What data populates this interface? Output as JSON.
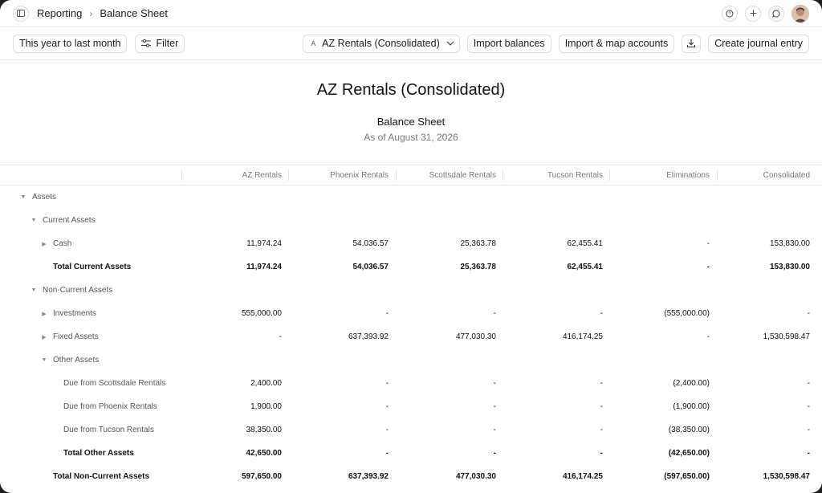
{
  "breadcrumb": {
    "section": "Reporting",
    "page": "Balance Sheet"
  },
  "toolbar": {
    "date_range": "This year to last month",
    "filter": "Filter",
    "entity_letter": "A",
    "entity": "AZ Rentals (Consolidated)",
    "import_balances": "Import balances",
    "import_map": "Import & map accounts",
    "create_journal": "Create journal entry"
  },
  "report": {
    "title": "AZ Rentals (Consolidated)",
    "subtitle": "Balance Sheet",
    "date": "As of August 31, 2026"
  },
  "columns": [
    "AZ Rentals",
    "Phoenix Rentals",
    "Scottsdale Rentals",
    "Tucson Rentals",
    "Eliminations",
    "Consolidated"
  ],
  "rows": [
    {
      "label": "Assets",
      "indent": 0,
      "caret": "down",
      "total": false,
      "values": []
    },
    {
      "label": "Current Assets",
      "indent": 1,
      "caret": "down",
      "total": false,
      "values": []
    },
    {
      "label": "Cash",
      "indent": 2,
      "caret": "right",
      "total": false,
      "values": [
        "11,974.24",
        "54,036.57",
        "25,363.78",
        "62,455.41",
        "-",
        "153,830.00"
      ]
    },
    {
      "label": "Total Current Assets",
      "indent": 2,
      "caret": "",
      "total": true,
      "values": [
        "11,974.24",
        "54,036.57",
        "25,363.78",
        "62,455.41",
        "-",
        "153,830.00"
      ]
    },
    {
      "label": "Non-Current Assets",
      "indent": 1,
      "caret": "down",
      "total": false,
      "values": []
    },
    {
      "label": "Investments",
      "indent": 2,
      "caret": "right",
      "total": false,
      "values": [
        "555,000.00",
        "-",
        "-",
        "-",
        "(555,000.00)",
        "-"
      ]
    },
    {
      "label": "Fixed Assets",
      "indent": 2,
      "caret": "right",
      "total": false,
      "values": [
        "-",
        "637,393.92",
        "477,030.30",
        "416,174.25",
        "-",
        "1,530,598.47"
      ]
    },
    {
      "label": "Other Assets",
      "indent": 2,
      "caret": "down",
      "total": false,
      "values": []
    },
    {
      "label": "Due from Scottsdale Rentals",
      "indent": 3,
      "caret": "",
      "total": false,
      "values": [
        "2,400.00",
        "-",
        "-",
        "-",
        "(2,400.00)",
        "-"
      ]
    },
    {
      "label": "Due from Phoenix Rentals",
      "indent": 3,
      "caret": "",
      "total": false,
      "values": [
        "1,900.00",
        "-",
        "-",
        "-",
        "(1,900.00)",
        "-"
      ]
    },
    {
      "label": "Due from Tucson Rentals",
      "indent": 3,
      "caret": "",
      "total": false,
      "values": [
        "38,350.00",
        "-",
        "-",
        "-",
        "(38,350.00)",
        "-"
      ]
    },
    {
      "label": "Total Other Assets",
      "indent": 3,
      "caret": "",
      "total": true,
      "values": [
        "42,650.00",
        "-",
        "-",
        "-",
        "(42,650.00)",
        "-"
      ]
    },
    {
      "label": "Total Non-Current Assets",
      "indent": 2,
      "caret": "",
      "total": true,
      "values": [
        "597,650.00",
        "637,393.92",
        "477,030.30",
        "416,174.25",
        "(597,650.00)",
        "1,530,598.47"
      ]
    }
  ]
}
